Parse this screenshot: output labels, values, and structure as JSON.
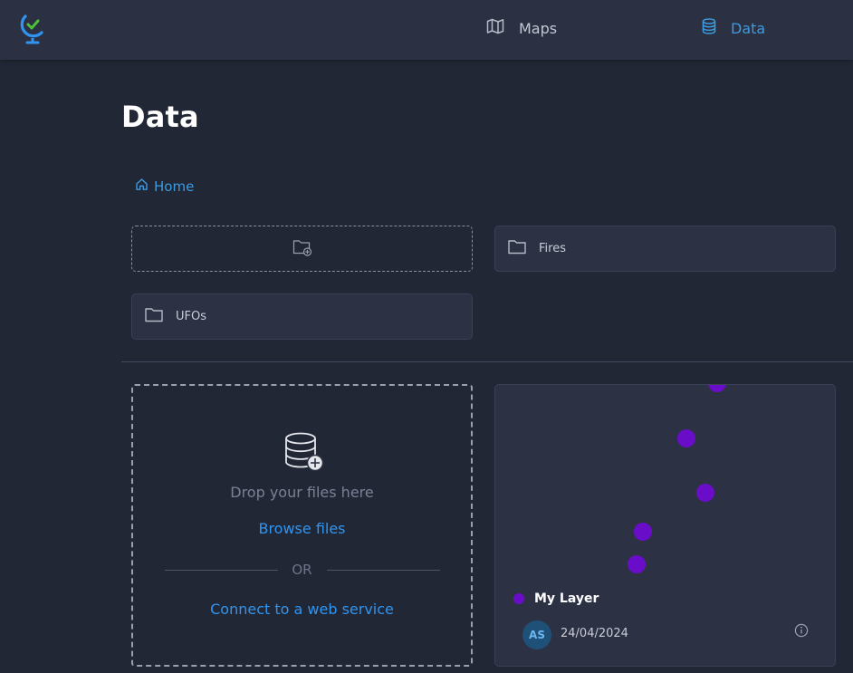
{
  "nav": {
    "logo_icon": "globe-logo-icon",
    "items": [
      {
        "label": "Maps",
        "icon": "map-icon",
        "active": false
      },
      {
        "label": "Data",
        "icon": "database-icon",
        "active": true
      }
    ]
  },
  "page": {
    "title": "Data",
    "breadcrumb": {
      "label": "Home",
      "icon": "home-icon"
    }
  },
  "folders": {
    "new_folder_icon": "folder-add-icon",
    "items": [
      {
        "label": "Fires",
        "icon": "folder-icon"
      },
      {
        "label": "UFOs",
        "icon": "folder-icon"
      }
    ]
  },
  "upload": {
    "icon": "database-add-icon",
    "drop_text": "Drop your files here",
    "browse_label": "Browse files",
    "or_label": "OR",
    "connect_label": "Connect to a web service"
  },
  "layer": {
    "name": "My Layer",
    "color": "#6a0dc9",
    "owner_initials": "AS",
    "date": "24/04/2024",
    "info_icon": "info-icon"
  },
  "colors": {
    "accent": "#2f95f0",
    "background": "#222736",
    "card": "#2c3144",
    "layer_point": "#6a0dc9"
  }
}
